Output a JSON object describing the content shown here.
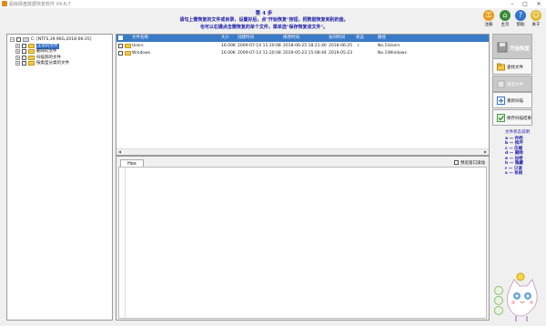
{
  "window": {
    "title": "超级硬盘数据恢复软件 V4.8.7"
  },
  "hints": {
    "step": "第 4 步",
    "line1": "请勾上需恢复的文件或目录，设置好后，点\"开始恢复\"按钮，把数据恢复到别的盘。",
    "line2": "也可以右键点击需恢复的单个文件，菜单选\"保存恢复该文件\"。"
  },
  "topbar": [
    {
      "label": "注册",
      "icon": "key-icon",
      "color": "#e89b1c",
      "glyph": "⚿"
    },
    {
      "label": "主页",
      "icon": "home-icon",
      "color": "#3b8b3b",
      "glyph": "⌂"
    },
    {
      "label": "帮助",
      "icon": "help-icon",
      "color": "#3373c9",
      "glyph": "?"
    },
    {
      "label": "关于",
      "icon": "smiley-icon",
      "color": "#e0b82a",
      "glyph": "☺"
    }
  ],
  "tree": [
    {
      "label": "C: [NTFS,39.96G,2018-06-25]",
      "selected": false
    },
    {
      "label": "正常的文件",
      "selected": true
    },
    {
      "label": "删除的文件",
      "selected": false
    },
    {
      "label": "扫描到的文件",
      "selected": false
    },
    {
      "label": "按类型分类的文件",
      "selected": false
    }
  ],
  "filelist": {
    "columns": [
      "文件名称",
      "大小",
      "创建时间",
      "修改时间",
      "访问时间",
      "状态",
      "路径"
    ],
    "rows": [
      {
        "name": "Users",
        "size": "16.00K",
        "created": "2009-07-14 11:20:08",
        "modified": "2018-06-25 18:21:40",
        "accessed": "2018-06-25",
        "status": "r",
        "path": "No.1\\Users"
      },
      {
        "name": "Windows",
        "size": "16.00K",
        "created": "2009-07-14 11:20:08",
        "modified": "2019-05-23 15:08:44",
        "accessed": "2019-05-23",
        "status": "",
        "path": "No.1\\Windows"
      }
    ]
  },
  "hex": {
    "tab": "Hex",
    "sync_label": "预览窗口滚动"
  },
  "side": {
    "start": "开始恢复",
    "find": "查找文件",
    "filter": "筛选文件",
    "rescan": "重新扫描",
    "save_scan": "保存扫描结果"
  },
  "legend": {
    "title": "文件状态说明",
    "items": [
      "a — 存档",
      "b — 损坏",
      "c — 压缩",
      "d — 删除",
      "e — 加密",
      "h — 隐藏",
      "r — 只读",
      "s — 系统"
    ]
  },
  "colors": {
    "header_blue": "#3a7bc8",
    "hint_text": "#1a1aa8",
    "legend_text": "#1a1aa8"
  }
}
